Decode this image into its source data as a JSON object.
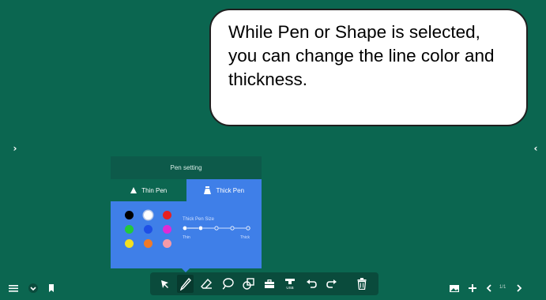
{
  "callout": {
    "text": "While Pen or Shape is selected, you can change the line color and thickness."
  },
  "side_arrows": {
    "left": "›",
    "right": "‹"
  },
  "pen_setting": {
    "title": "Pen setting",
    "tabs": [
      {
        "label": "Thin Pen",
        "selected": false
      },
      {
        "label": "Thick Pen",
        "selected": true
      }
    ],
    "colors": [
      "#000000",
      "#ffffff",
      "#e82020",
      "#22c93a",
      "#1e4fe6",
      "#e02ad6",
      "#f2e021",
      "#f07a28",
      "#f59aa8"
    ],
    "selected_color": "#ffffff",
    "size_label": "Thick Pen Size",
    "size_min_label": "Thin",
    "size_max_label": "Thick",
    "size_steps": 5,
    "size_selected_step": 2
  },
  "toolbar": {
    "tools": [
      "select-arrow",
      "pen",
      "eraser",
      "lasso",
      "shapes",
      "toolbox",
      "usb",
      "undo",
      "redo",
      "delete"
    ],
    "active_tool": "pen",
    "usb_label": "USB"
  },
  "bottom_left": [
    "menu-icon",
    "chevron-down-icon",
    "bookmark-icon"
  ],
  "bottom_right": {
    "page_indicator": "1/1"
  },
  "colors": {
    "background": "#0b6650",
    "panel_accent": "#3f7fe8",
    "toolbar": "#0a4b3c"
  }
}
